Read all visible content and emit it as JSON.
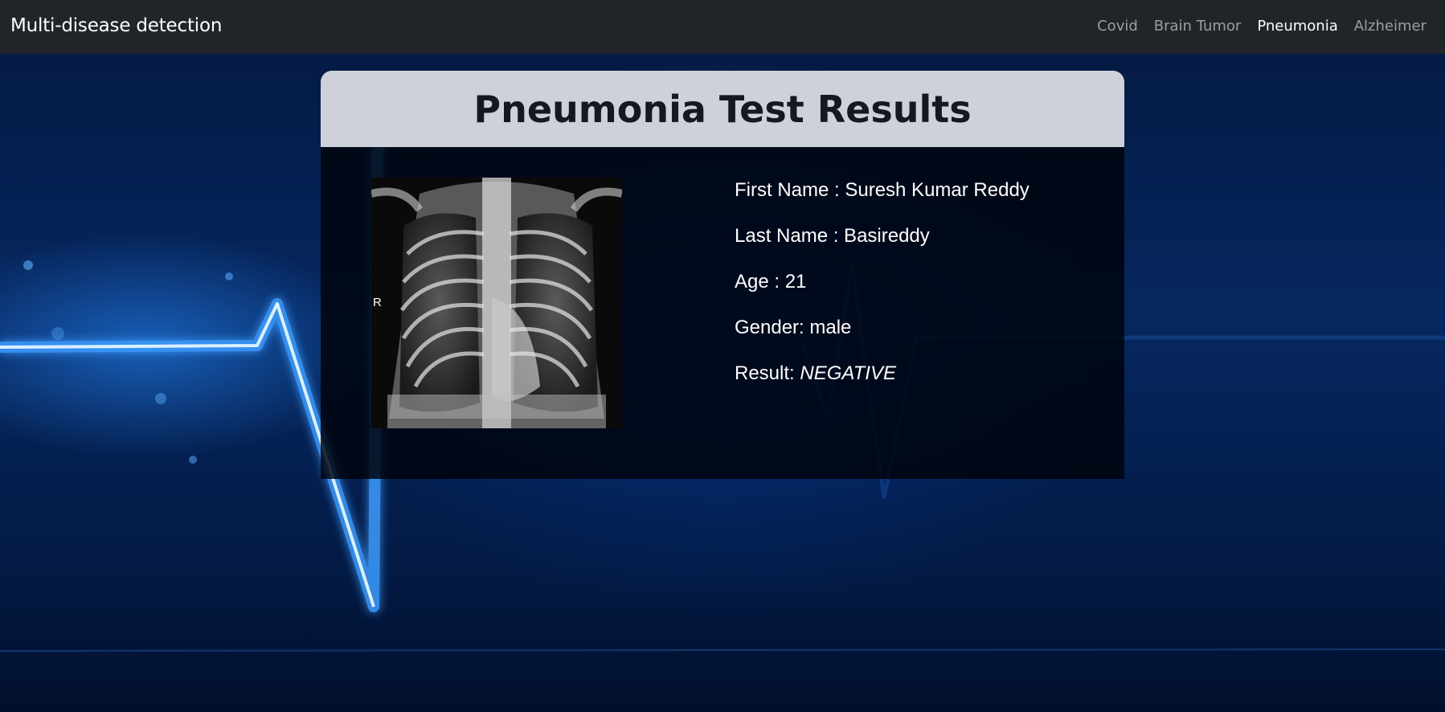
{
  "navbar": {
    "brand": "Multi-disease detection",
    "links": [
      {
        "label": "Covid",
        "active": false
      },
      {
        "label": "Brain Tumor",
        "active": false
      },
      {
        "label": "Pneumonia",
        "active": true
      },
      {
        "label": "Alzheimer",
        "active": false
      }
    ]
  },
  "card": {
    "title": "Pneumonia Test Results",
    "xray": {
      "icon": "chest-xray-image",
      "marker_label": "R"
    },
    "patient": {
      "first_name_line": "First Name : Suresh Kumar Reddy",
      "last_name_line": "Last Name : Basireddy",
      "age_line": "Age : 21",
      "gender_line": "Gender: male",
      "result_label": "Result: ",
      "result_value": "NEGATIVE"
    }
  },
  "colors": {
    "navbar_bg": "#212529",
    "header_bg": "#ced1d9",
    "accent_glow": "#2a8cff"
  }
}
